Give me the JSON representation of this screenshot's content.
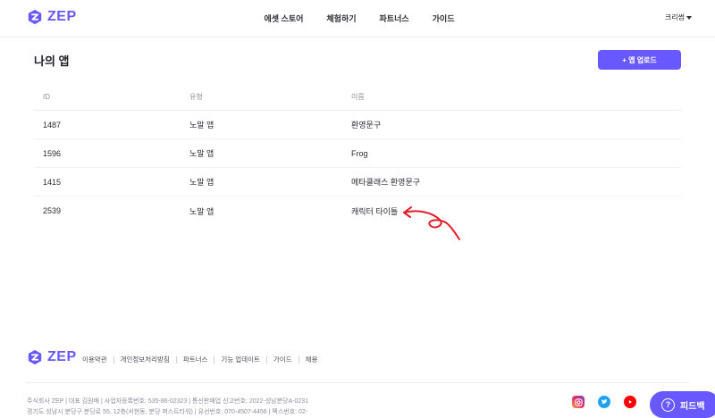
{
  "brand": {
    "name": "ZEP",
    "color": "#6758ff"
  },
  "nav": {
    "items": [
      "에셋 스토어",
      "체험하기",
      "파트너스",
      "가이드"
    ]
  },
  "user": {
    "name": "크리썸"
  },
  "page": {
    "title": "나의 앱",
    "upload_label": "+ 앱 업로드"
  },
  "table": {
    "columns": [
      "ID",
      "유형",
      "이름"
    ],
    "rows": [
      {
        "id": "1487",
        "type": "노말 앱",
        "name": "환영문구"
      },
      {
        "id": "1596",
        "type": "노말 앱",
        "name": "Frog"
      },
      {
        "id": "1415",
        "type": "노말 앱",
        "name": "메타클래스 환영문구"
      },
      {
        "id": "2539",
        "type": "노말 앱",
        "name": "캐릭터 타이틀"
      }
    ]
  },
  "footer": {
    "links": [
      "이용약관",
      "개인정보처리방침",
      "파트너스",
      "기능 업데이트",
      "가이드",
      "채용"
    ],
    "company_line1": "주식회사 ZEP  |  대표 김원배  |  사업자등록번호: 535-86-02323  |  통신판매업 신고번호: 2022-성남분당A-0231",
    "company_line2": "경기도 성남시 분당구 분당로 55, 12층(서현동, 분당 퍼스트타워)  |  유선번호: 070-4507-4456  |  팩스번호: 02-",
    "social": [
      "instagram-icon",
      "twitter-icon",
      "youtube-icon"
    ]
  },
  "feedback": {
    "label": "피드백"
  },
  "annotation_color": "#e0202a"
}
